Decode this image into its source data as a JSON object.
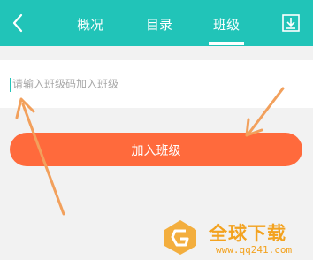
{
  "header": {
    "back_icon": "chevron-left-icon",
    "tabs": [
      {
        "label": "概况"
      },
      {
        "label": "目录"
      },
      {
        "label": "班级"
      }
    ],
    "active_tab": "班级",
    "download_icon": "download-icon"
  },
  "form": {
    "placeholder": "请输入班级码加入班级",
    "value": ""
  },
  "join_button": {
    "label": "加入班级"
  },
  "watermark": {
    "text": "全球下载",
    "url": "www.qq241.com"
  },
  "colors": {
    "header": "#21c4b8",
    "button": "#ff6a3c",
    "arrow": "#f2a05c",
    "watermark": "#f3a21f"
  }
}
